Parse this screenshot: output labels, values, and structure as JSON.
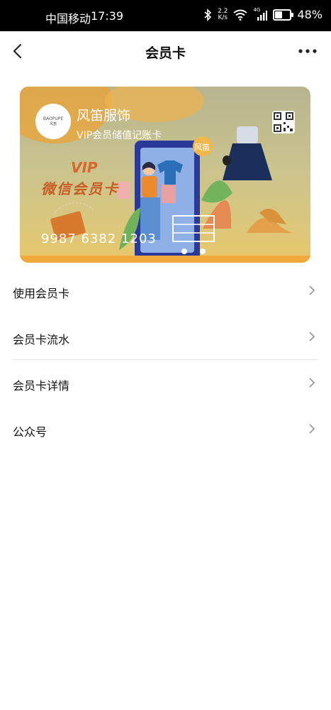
{
  "status_bar": {
    "carrier": "中国移动",
    "time": "17:39",
    "net_speed_value": "2.2",
    "net_speed_unit": "K/s",
    "signal_label": "4G",
    "battery_percent": "48%",
    "battery_level": 0.48
  },
  "header": {
    "title": "会员卡",
    "back_icon": "chevron-left-icon",
    "more_icon": "more-dots-icon"
  },
  "card": {
    "logo_text": "BAOPUPE",
    "logo_subtext": "风笛",
    "store_name": "风笛服饰",
    "card_type": "VIP会员储值记账卡",
    "vip_text": "VIP",
    "wechat_card_text": "微信会员卡",
    "card_number": "9987 6382 1203",
    "brand_badge": "风笛",
    "qr_icon": "qr-code-icon"
  },
  "menu": {
    "items": [
      {
        "label": "使用会员卡"
      },
      {
        "label": "会员卡流水"
      },
      {
        "label": "会员卡详情"
      },
      {
        "label": "公众号"
      }
    ]
  },
  "colors": {
    "card_accent": "#f2a93b",
    "vip_text": "#d9682b"
  }
}
